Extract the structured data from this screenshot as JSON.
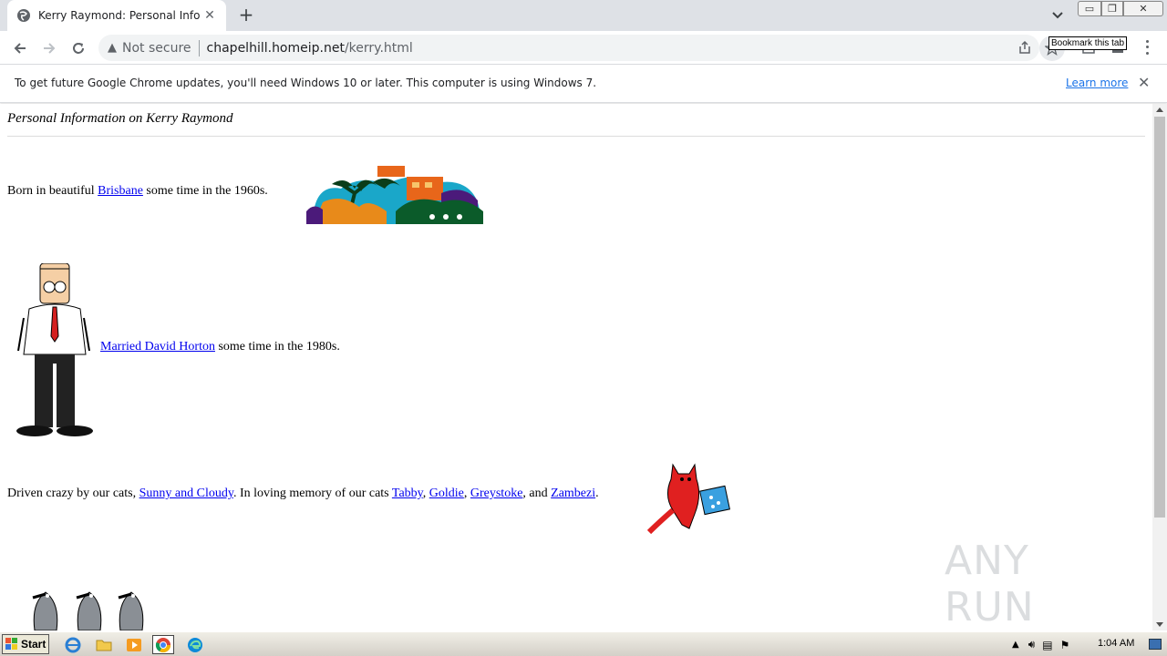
{
  "browser": {
    "tab": {
      "title": "Kerry Raymond: Personal Information on Kerry Raymond"
    },
    "omnibox": {
      "security_label": "Not secure",
      "host": "chapelhill.homeip.net",
      "path": "/kerry.html"
    },
    "tooltip": "Bookmark this tab",
    "infobar": {
      "message": "To get future Google Chrome updates, you'll need Windows 10 or later. This computer is using Windows 7.",
      "link": "Learn more"
    }
  },
  "page": {
    "heading": "Personal Information on Kerry Raymond",
    "line1": {
      "pre": "Born in beautiful ",
      "link": "Brisbane",
      "post": " some time in the 1960s."
    },
    "line2": {
      "link": "Married David Horton",
      "post": " some time in the 1980s."
    },
    "line3": {
      "pre": "Driven crazy by our cats, ",
      "link1": "Sunny and Cloudy",
      "mid": ". In loving memory of our cats ",
      "link2": "Tabby",
      "sep1": ", ",
      "link3": "Goldie",
      "sep2": ", ",
      "link4": "Greystoke",
      "sep3": ", and ",
      "link5": "Zambezi",
      "end": "."
    }
  },
  "watermark": "ANY RUN",
  "taskbar": {
    "start": "Start",
    "clock": "1:04 AM"
  },
  "colors": {
    "link": "#0000ee",
    "chrome_tabstrip": "#dee1e6",
    "learn_more": "#1a73e8"
  },
  "icons": [
    "globe-icon",
    "close-icon",
    "plus-icon",
    "chevron-down-icon",
    "back-icon",
    "forward-icon",
    "reload-icon",
    "warning-icon",
    "share-icon",
    "star-icon",
    "extensions-icon",
    "profile-icon",
    "menu-icon"
  ]
}
